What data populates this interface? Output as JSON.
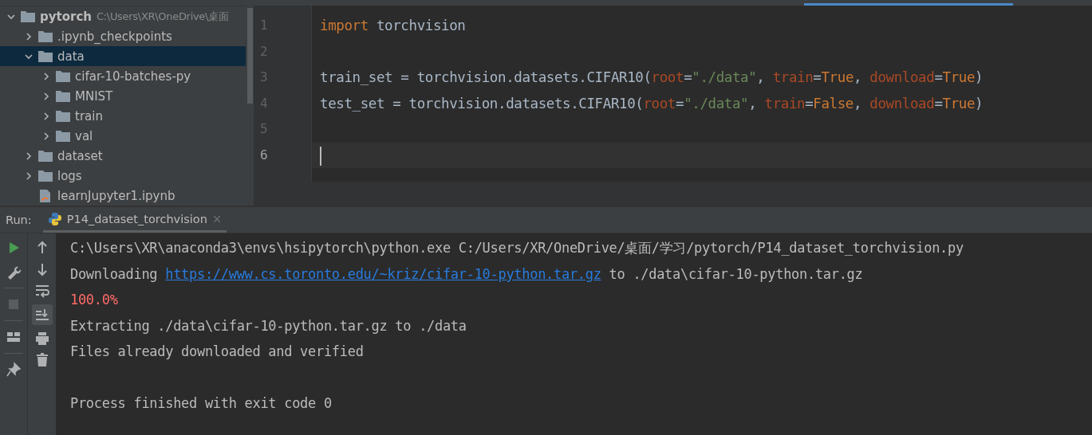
{
  "project_tree": {
    "items": [
      {
        "kind": "folder",
        "label": "pytorch",
        "hint": "C:\\Users\\XR\\OneDrive\\桌面",
        "expanded": true,
        "selected": false,
        "children": [
          {
            "kind": "folder",
            "label": ".ipynb_checkpoints",
            "expanded": false,
            "selected": false
          },
          {
            "kind": "folder",
            "label": "data",
            "expanded": true,
            "selected": true,
            "children": [
              {
                "kind": "folder",
                "label": "cifar-10-batches-py",
                "expanded": false,
                "selected": false
              },
              {
                "kind": "folder",
                "label": "MNIST",
                "expanded": false,
                "selected": false
              },
              {
                "kind": "folder",
                "label": "train",
                "expanded": false,
                "selected": false
              },
              {
                "kind": "folder",
                "label": "val",
                "expanded": false,
                "selected": false
              }
            ]
          },
          {
            "kind": "folder",
            "label": "dataset",
            "expanded": false,
            "selected": false
          },
          {
            "kind": "folder",
            "label": "logs",
            "expanded": false,
            "selected": false
          },
          {
            "kind": "notebook",
            "label": "learnJupyter1.ipynb",
            "selected": false
          }
        ]
      }
    ]
  },
  "editor": {
    "lines": [
      {
        "number": "1",
        "current": false,
        "tokens": [
          {
            "kind": "keyword",
            "text": "import"
          },
          {
            "kind": "plain",
            "text": " torchvision"
          }
        ]
      },
      {
        "number": "2",
        "current": false
      },
      {
        "number": "3",
        "current": false,
        "tokens": [
          {
            "kind": "plain",
            "text": "train_set = torchvision.datasets.CIFAR10("
          },
          {
            "kind": "param",
            "text": "root"
          },
          {
            "kind": "plain",
            "text": "="
          },
          {
            "kind": "string",
            "text": "\"./data\""
          },
          {
            "kind": "plain",
            "text": ", "
          },
          {
            "kind": "param",
            "text": "train"
          },
          {
            "kind": "plain",
            "text": "="
          },
          {
            "kind": "keyword",
            "text": "True"
          },
          {
            "kind": "plain",
            "text": ", "
          },
          {
            "kind": "param",
            "text": "download"
          },
          {
            "kind": "plain",
            "text": "="
          },
          {
            "kind": "keyword",
            "text": "True"
          },
          {
            "kind": "plain",
            "text": ")"
          }
        ]
      },
      {
        "number": "4",
        "current": false,
        "tokens": [
          {
            "kind": "plain",
            "text": "test_set = torchvision.datasets.CIFAR10("
          },
          {
            "kind": "param",
            "text": "root"
          },
          {
            "kind": "plain",
            "text": "="
          },
          {
            "kind": "string",
            "text": "\"./data\""
          },
          {
            "kind": "plain",
            "text": ", "
          },
          {
            "kind": "param",
            "text": "train"
          },
          {
            "kind": "plain",
            "text": "="
          },
          {
            "kind": "keyword",
            "text": "False"
          },
          {
            "kind": "plain",
            "text": ", "
          },
          {
            "kind": "param",
            "text": "download"
          },
          {
            "kind": "plain",
            "text": "="
          },
          {
            "kind": "keyword",
            "text": "True"
          },
          {
            "kind": "plain",
            "text": ")"
          }
        ]
      },
      {
        "number": "5",
        "current": false
      },
      {
        "number": "6",
        "current": true
      }
    ]
  },
  "run_panel": {
    "label": "Run:",
    "tab": {
      "title": "P14_dataset_torchvision",
      "close": "×",
      "selected": true
    },
    "console": [
      {
        "segments": [
          {
            "kind": "plain",
            "text": "C:\\Users\\XR\\anaconda3\\envs\\hsipytorch\\python.exe C:/Users/XR/OneDrive/桌面/学习/pytorch/P14_dataset_torchvision.py"
          }
        ]
      },
      {
        "segments": [
          {
            "kind": "plain",
            "text": "Downloading "
          },
          {
            "kind": "link",
            "text": "https://www.cs.toronto.edu/~kriz/cifar-10-python.tar.gz"
          },
          {
            "kind": "plain",
            "text": " to ./data\\cifar-10-python.tar.gz"
          }
        ]
      },
      {
        "segments": [
          {
            "kind": "error",
            "text": "100.0%"
          }
        ]
      },
      {
        "segments": [
          {
            "kind": "plain",
            "text": "Extracting ./data\\cifar-10-python.tar.gz to ./data"
          }
        ]
      },
      {
        "segments": [
          {
            "kind": "plain",
            "text": "Files already downloaded and verified"
          }
        ]
      },
      {
        "gap_before": true,
        "segments": [
          {
            "kind": "plain",
            "text": "Process finished with exit code 0"
          }
        ]
      }
    ]
  }
}
